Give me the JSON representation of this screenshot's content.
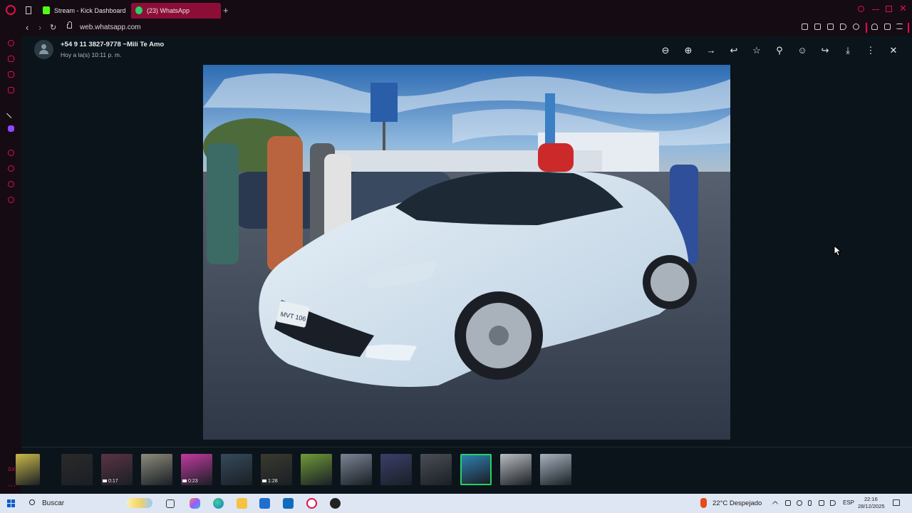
{
  "browser": {
    "tabs": [
      {
        "label": "Stream - Kick Dashboard",
        "active": false
      },
      {
        "label": "(23) WhatsApp",
        "active": true
      }
    ],
    "new_tab_label": "+",
    "url": "web.whatsapp.com",
    "accent_color": "#e0104a"
  },
  "viewer": {
    "contact_name": "+54 9 11 3827-9778 ~Mili Te Amo",
    "timestamp": "Hoy a la(s) 10:11 p. m.",
    "actions": [
      {
        "name": "zoom-out",
        "glyph": "⊖"
      },
      {
        "name": "zoom-in",
        "glyph": "⊕"
      },
      {
        "name": "go-to-message",
        "glyph": "→"
      },
      {
        "name": "reply",
        "glyph": "↩"
      },
      {
        "name": "star",
        "glyph": "☆"
      },
      {
        "name": "pin",
        "glyph": "⚲"
      },
      {
        "name": "react",
        "glyph": "☺"
      },
      {
        "name": "forward",
        "glyph": "↪"
      },
      {
        "name": "download",
        "glyph": "⤓"
      },
      {
        "name": "menu",
        "glyph": "⋮"
      },
      {
        "name": "close",
        "glyph": "✕"
      }
    ],
    "photo_plate_text": "MVT 106",
    "thumbnails": [
      {
        "color": "#c9b94a",
        "duration": ""
      },
      {
        "color": "#2a2a2a",
        "duration": ""
      },
      {
        "color": "#5a3344",
        "duration": "0:17"
      },
      {
        "color": "#8d8b7c",
        "duration": ""
      },
      {
        "color": "#c23a9f",
        "duration": "0:23"
      },
      {
        "color": "#364a5a",
        "duration": ""
      },
      {
        "color": "#3a3a2e",
        "duration": "1:28"
      },
      {
        "color": "#6f9a3a",
        "duration": ""
      },
      {
        "color": "#7a8494",
        "duration": ""
      },
      {
        "color": "#3b3f6b",
        "duration": ""
      },
      {
        "color": "#4b4f55",
        "duration": ""
      },
      {
        "color": "#2f7fb0",
        "duration": "",
        "selected": true
      },
      {
        "color": "#b9bcc0",
        "duration": ""
      },
      {
        "color": "#a8b3bf",
        "duration": ""
      }
    ]
  },
  "taskbar": {
    "search_label": "Buscar",
    "weather": "22°C  Despejado",
    "language": "ESP",
    "time": "22:16",
    "date": "28/12/2025"
  }
}
